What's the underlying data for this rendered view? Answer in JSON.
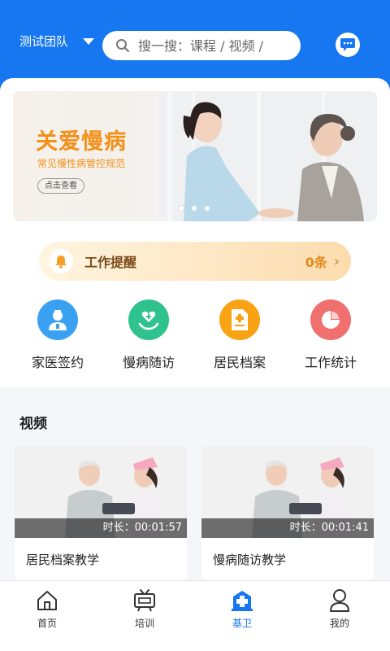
{
  "header": {
    "team_name": "测试团队",
    "search_placeholder": "搜一搜：课程 / 视频 /"
  },
  "banner": {
    "title": "关爱慢病",
    "subtitle": "常见慢性病管控规范",
    "button": "点击查看",
    "slide_count": 3,
    "active_slide": 1
  },
  "reminder": {
    "label": "工作提醒",
    "count": "0条"
  },
  "actions": [
    {
      "label": "家医签约",
      "icon": "doctor-icon",
      "color": "#3aa1f2"
    },
    {
      "label": "慢病随访",
      "icon": "heart-hand-icon",
      "color": "#2fc28f"
    },
    {
      "label": "居民档案",
      "icon": "medical-record-icon",
      "color": "#f8a214"
    },
    {
      "label": "工作统计",
      "icon": "pie-chart-icon",
      "color": "#f0706f"
    }
  ],
  "videos": {
    "section_title": "视频",
    "items": [
      {
        "title": "居民档案教学",
        "duration": "时长：00:01:57"
      },
      {
        "title": "慢病随访教学",
        "duration": "时长：00:01:41"
      }
    ]
  },
  "tabbar": {
    "items": [
      {
        "label": "首页",
        "icon": "home-icon"
      },
      {
        "label": "培训",
        "icon": "tv-icon"
      },
      {
        "label": "基卫",
        "icon": "hospital-icon",
        "active": true
      },
      {
        "label": "我的",
        "icon": "user-icon"
      }
    ]
  },
  "colors": {
    "primary": "#1677f0",
    "banner_accent": "#f39019",
    "reminder_count": "#e08a1e"
  }
}
